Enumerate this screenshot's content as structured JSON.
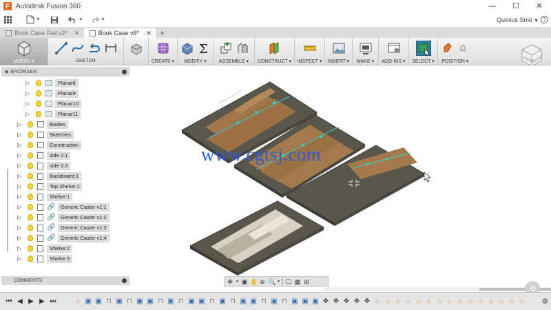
{
  "window": {
    "title": "Autodesk Fusion 360",
    "controls": [
      "—",
      "☐",
      "✕"
    ]
  },
  "quickbar": {
    "user": "Quintus Smit",
    "help": "?"
  },
  "tabs": [
    {
      "label": "Book Case Flat v2*",
      "active": false
    },
    {
      "label": "Book Case v8*",
      "active": true
    }
  ],
  "ribbon": {
    "workspace": "MODEL",
    "groups": [
      "SKETCH",
      "CREATE",
      "MODIFY",
      "ASSEMBLE",
      "CONSTRUCT",
      "INSPECT",
      "INSERT",
      "MAKE",
      "ADD-INS",
      "SELECT",
      "POSITION"
    ]
  },
  "browser": {
    "title": "BROWSER",
    "items": [
      {
        "label": "Planar8"
      },
      {
        "label": "Planar9"
      },
      {
        "label": "Planar10"
      },
      {
        "label": "Planar11"
      },
      {
        "label": "Bodies"
      },
      {
        "label": "Sketches"
      },
      {
        "label": "Construction"
      },
      {
        "label": "side 2:1"
      },
      {
        "label": "side 2:3"
      },
      {
        "label": "Backboard:1"
      },
      {
        "label": "Top Shelve:1"
      },
      {
        "label": "Shelve:1"
      },
      {
        "label": "Generic Caster v1:1"
      },
      {
        "label": "Generic Caster v1:2"
      },
      {
        "label": "Generic Caster v1:3"
      },
      {
        "label": "Generic Caster v1:4"
      },
      {
        "label": "Shelve:2"
      },
      {
        "label": "Shelve:3"
      }
    ]
  },
  "comments": {
    "title": "COMMENTS"
  },
  "watermark": "www.cgtsj.com",
  "colors": {
    "wood": "#a0764a",
    "board": "#5a564c",
    "accent": "#2e7e9e",
    "watermark": "#2d5bd3"
  }
}
